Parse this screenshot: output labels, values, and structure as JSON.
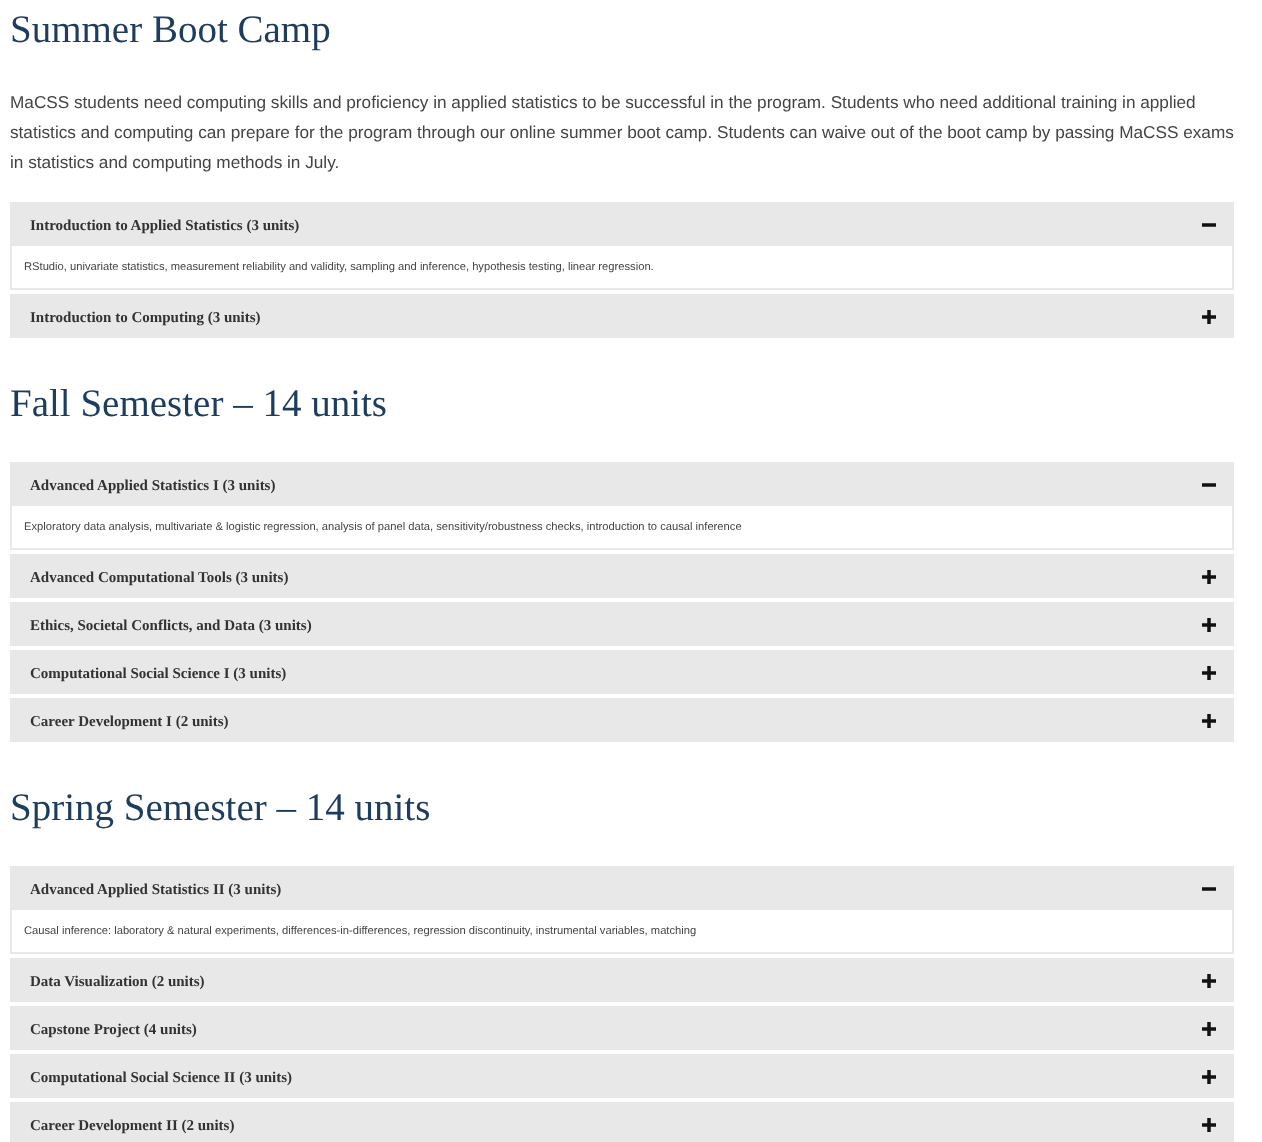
{
  "sections": [
    {
      "title": "Summer Boot Camp",
      "intro": "MaCSS students need computing skills and proficiency in applied statistics to be successful in the program. Students who need additional training in applied statistics and computing can prepare for the program through our online summer boot camp. Students can waive out of the boot camp by passing MaCSS exams in statistics and computing methods in July.",
      "items": [
        {
          "title": "Introduction to Applied Statistics (3 units)",
          "expanded": true,
          "details": "RStudio, univariate statistics, measurement reliability and validity, sampling and inference, hypothesis testing, linear regression."
        },
        {
          "title": "Introduction to Computing (3 units)",
          "expanded": false
        }
      ]
    },
    {
      "title": "Fall Semester – 14 units",
      "items": [
        {
          "title": "Advanced Applied Statistics I (3 units)",
          "expanded": true,
          "details": "Exploratory data analysis, multivariate & logistic regression, analysis of panel data, sensitivity/robustness checks, introduction to causal inference"
        },
        {
          "title": "Advanced Computational Tools (3 units)",
          "expanded": false
        },
        {
          "title": "Ethics, Societal Conflicts, and Data (3 units)",
          "expanded": false
        },
        {
          "title": "Computational Social Science I (3 units)",
          "expanded": false
        },
        {
          "title": "Career Development I (2 units)",
          "expanded": false
        }
      ]
    },
    {
      "title": "Spring Semester – 14 units",
      "items": [
        {
          "title": "Advanced Applied Statistics II (3 units)",
          "expanded": true,
          "details": "Causal inference: laboratory & natural experiments, differences-in-differences, regression discontinuity, instrumental variables, matching"
        },
        {
          "title": "Data Visualization (2 units)",
          "expanded": false
        },
        {
          "title": "Capstone Project (4 units)",
          "expanded": false
        },
        {
          "title": "Computational Social Science II (3 units)",
          "expanded": false
        },
        {
          "title": "Career Development II (2 units)",
          "expanded": false
        }
      ]
    }
  ]
}
